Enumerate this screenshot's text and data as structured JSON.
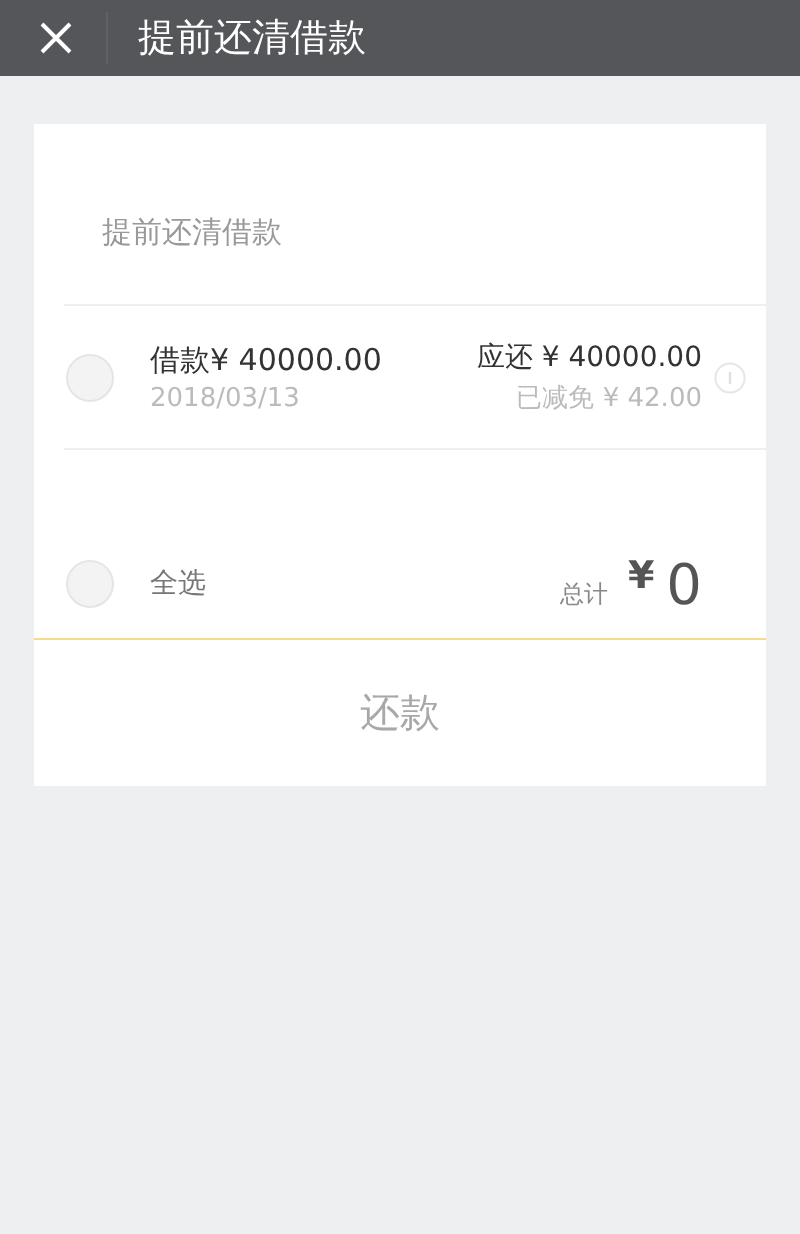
{
  "header": {
    "title": "提前还清借款"
  },
  "section": {
    "title": "提前还清借款"
  },
  "loans": [
    {
      "label": "借款¥ 40000.00",
      "date": "2018/03/13",
      "due": "应还 ¥ 40000.00",
      "waived": "已减免 ¥ 42.00",
      "checked": false
    }
  ],
  "footer": {
    "select_all": {
      "label": "全选",
      "checked": false
    },
    "total_label": "总计",
    "currency": "¥",
    "total": "0"
  },
  "pay_button": {
    "label": "还款",
    "disabled": true
  }
}
